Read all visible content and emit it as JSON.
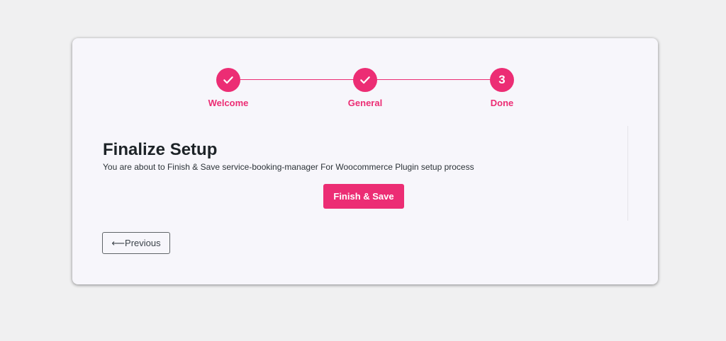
{
  "stepper": {
    "steps": [
      {
        "label": "Welcome",
        "status": "complete",
        "icon": "check-icon"
      },
      {
        "label": "General",
        "status": "complete",
        "icon": "check-icon"
      },
      {
        "label": "Done",
        "status": "current",
        "number": "3"
      }
    ]
  },
  "content": {
    "title": "Finalize Setup",
    "description": "You are about to Finish & Save service-booking-manager For Woocommerce Plugin setup process",
    "finish_label": "Finish & Save"
  },
  "footer": {
    "previous_label": "⟵Previous"
  },
  "colors": {
    "accent": "#ec2d74",
    "card_background": "#f7f6fb",
    "page_background": "#f0f0f1",
    "title_text": "#1d2327"
  }
}
